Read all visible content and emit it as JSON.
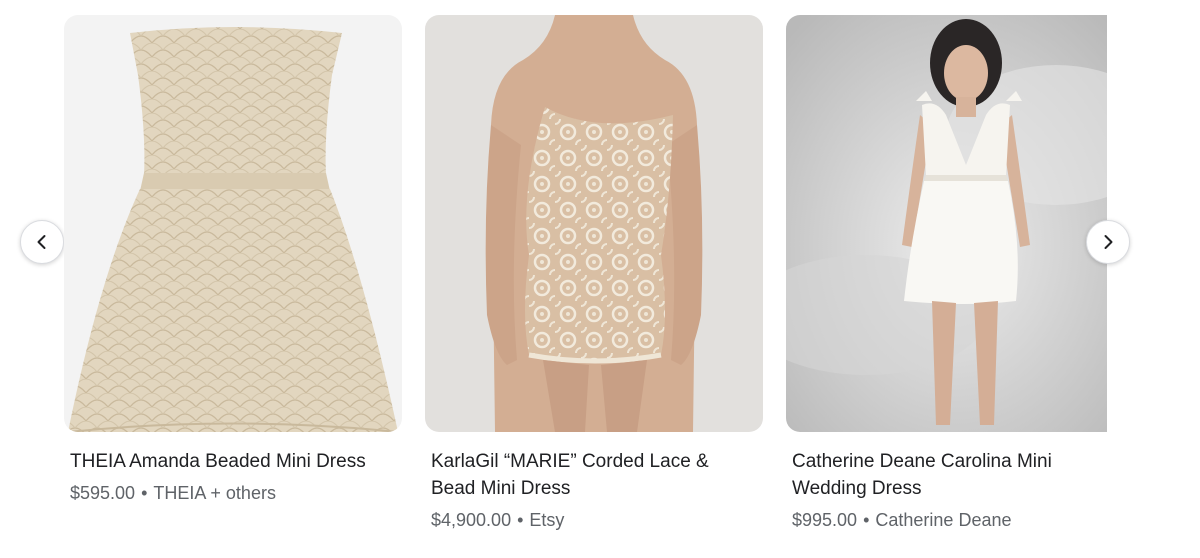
{
  "carousel": {
    "prev_icon": "chevron-left-icon",
    "next_icon": "chevron-right-icon",
    "items": [
      {
        "title": "THEIA Amanda Beaded Mini Dress",
        "price": "$595.00",
        "seller": "THEIA + others",
        "image_desc": "beaded-strapless-mini-dress"
      },
      {
        "title": "KarlaGil “MARIE” Corded Lace & Bead Mini Dress",
        "price": "$4,900.00",
        "seller": "Etsy",
        "image_desc": "corded-lace-mini-dress"
      },
      {
        "title": "Catherine Deane Carolina Mini Wedding Dress",
        "price": "$995.00",
        "seller": "Catherine Deane",
        "image_desc": "white-mini-wedding-dress"
      }
    ]
  },
  "colors": {
    "title_text": "#202124",
    "meta_text": "#5f6368",
    "dress_beige": "#e0d4bd",
    "lace_cream": "#efe6d6",
    "skin": "#d7b49a",
    "bg_gray": "#dcdcdc"
  }
}
